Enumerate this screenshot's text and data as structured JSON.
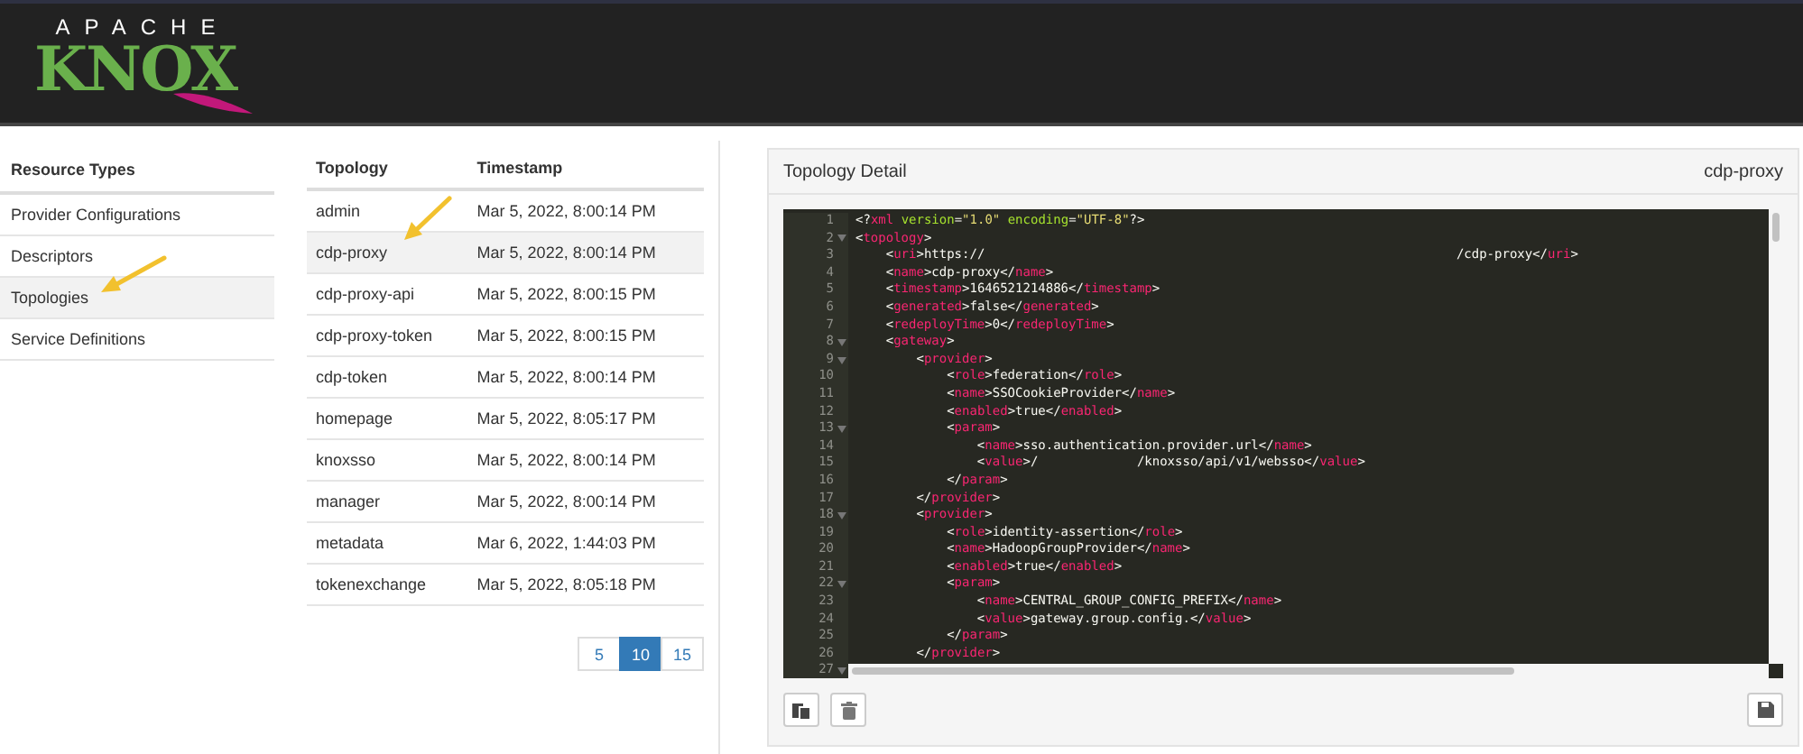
{
  "logo": {
    "top": "APACHE",
    "main": "KNOX"
  },
  "resource_types": {
    "title": "Resource Types",
    "items": [
      {
        "label": "Provider Configurations",
        "selected": false
      },
      {
        "label": "Descriptors",
        "selected": false
      },
      {
        "label": "Topologies",
        "selected": true
      },
      {
        "label": "Service Definitions",
        "selected": false
      }
    ]
  },
  "topology_table": {
    "columns": [
      "Topology",
      "Timestamp"
    ],
    "rows": [
      {
        "cells": [
          "admin",
          "Mar 5, 2022, 8:00:14 PM"
        ],
        "selected": false
      },
      {
        "cells": [
          "cdp-proxy",
          "Mar 5, 2022, 8:00:14 PM"
        ],
        "selected": true
      },
      {
        "cells": [
          "cdp-proxy-api",
          "Mar 5, 2022, 8:00:15 PM"
        ],
        "selected": false
      },
      {
        "cells": [
          "cdp-proxy-token",
          "Mar 5, 2022, 8:00:15 PM"
        ],
        "selected": false
      },
      {
        "cells": [
          "cdp-token",
          "Mar 5, 2022, 8:00:14 PM"
        ],
        "selected": false
      },
      {
        "cells": [
          "homepage",
          "Mar 5, 2022, 8:05:17 PM"
        ],
        "selected": false
      },
      {
        "cells": [
          "knoxsso",
          "Mar 5, 2022, 8:00:14 PM"
        ],
        "selected": false
      },
      {
        "cells": [
          "manager",
          "Mar 5, 2022, 8:00:14 PM"
        ],
        "selected": false
      },
      {
        "cells": [
          "metadata",
          "Mar 6, 2022, 1:44:03 PM"
        ],
        "selected": false
      },
      {
        "cells": [
          "tokenexchange",
          "Mar 5, 2022, 8:05:18 PM"
        ],
        "selected": false
      }
    ],
    "page_sizes": [
      {
        "label": "5",
        "selected": false
      },
      {
        "label": "10",
        "selected": true
      },
      {
        "label": "15",
        "selected": false
      }
    ]
  },
  "detail": {
    "title": "Topology Detail",
    "name": "cdp-proxy",
    "editor": [
      {
        "number": "1",
        "fold": false,
        "text": "<?xml version=\"1.0\" encoding=\"UTF-8\"?>"
      },
      {
        "number": "2",
        "fold": true,
        "text": "<topology>"
      },
      {
        "number": "3",
        "fold": false,
        "text": "    <uri>https://                                                              /cdp-proxy</uri>"
      },
      {
        "number": "4",
        "fold": false,
        "text": "    <name>cdp-proxy</name>"
      },
      {
        "number": "5",
        "fold": false,
        "text": "    <timestamp>1646521214886</timestamp>"
      },
      {
        "number": "6",
        "fold": false,
        "text": "    <generated>false</generated>"
      },
      {
        "number": "7",
        "fold": false,
        "text": "    <redeployTime>0</redeployTime>"
      },
      {
        "number": "8",
        "fold": true,
        "text": "    <gateway>"
      },
      {
        "number": "9",
        "fold": true,
        "text": "        <provider>"
      },
      {
        "number": "10",
        "fold": false,
        "text": "            <role>federation</role>"
      },
      {
        "number": "11",
        "fold": false,
        "text": "            <name>SSOCookieProvider</name>"
      },
      {
        "number": "12",
        "fold": false,
        "text": "            <enabled>true</enabled>"
      },
      {
        "number": "13",
        "fold": true,
        "text": "            <param>"
      },
      {
        "number": "14",
        "fold": false,
        "text": "                <name>sso.authentication.provider.url</name>"
      },
      {
        "number": "15",
        "fold": false,
        "text": "                <value>/             /knoxsso/api/v1/websso</value>"
      },
      {
        "number": "16",
        "fold": false,
        "text": "            </param>"
      },
      {
        "number": "17",
        "fold": false,
        "text": "        </provider>"
      },
      {
        "number": "18",
        "fold": true,
        "text": "        <provider>"
      },
      {
        "number": "19",
        "fold": false,
        "text": "            <role>identity-assertion</role>"
      },
      {
        "number": "20",
        "fold": false,
        "text": "            <name>HadoopGroupProvider</name>"
      },
      {
        "number": "21",
        "fold": false,
        "text": "            <enabled>true</enabled>"
      },
      {
        "number": "22",
        "fold": true,
        "text": "            <param>"
      },
      {
        "number": "23",
        "fold": false,
        "text": "                <name>CENTRAL_GROUP_CONFIG_PREFIX</name>"
      },
      {
        "number": "24",
        "fold": false,
        "text": "                <value>gateway.group.config.</value>"
      },
      {
        "number": "25",
        "fold": false,
        "text": "            </param>"
      },
      {
        "number": "26",
        "fold": false,
        "text": "        </provider>"
      },
      {
        "number": "27",
        "fold": true
      }
    ]
  }
}
